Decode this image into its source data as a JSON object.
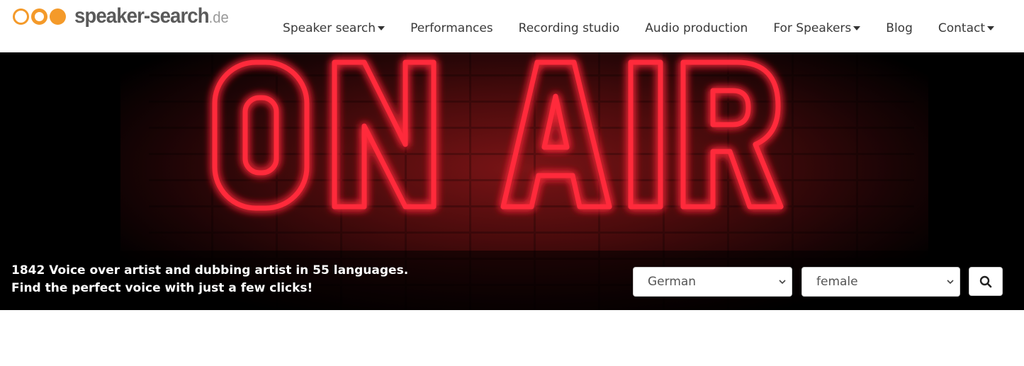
{
  "logo": {
    "name": "speaker-search",
    "tld": ".de",
    "accent": "#f49a2a"
  },
  "nav": {
    "items": [
      {
        "label": "Speaker search",
        "dropdown": true
      },
      {
        "label": "Performances",
        "dropdown": false
      },
      {
        "label": "Recording studio",
        "dropdown": false
      },
      {
        "label": "Audio production",
        "dropdown": false
      },
      {
        "label": "For Speakers",
        "dropdown": true
      },
      {
        "label": "Blog",
        "dropdown": false
      },
      {
        "label": "Contact",
        "dropdown": true
      }
    ]
  },
  "hero": {
    "sign_text": "ON AIR",
    "neon_color": "#ff2a3a",
    "tagline_line1": "1842 Voice over artist and dubbing artist in 55 languages.",
    "tagline_line2": "Find the perfect voice with just a few clicks!"
  },
  "search": {
    "language_value": "German",
    "gender_value": "female",
    "button_icon": "search-icon"
  }
}
